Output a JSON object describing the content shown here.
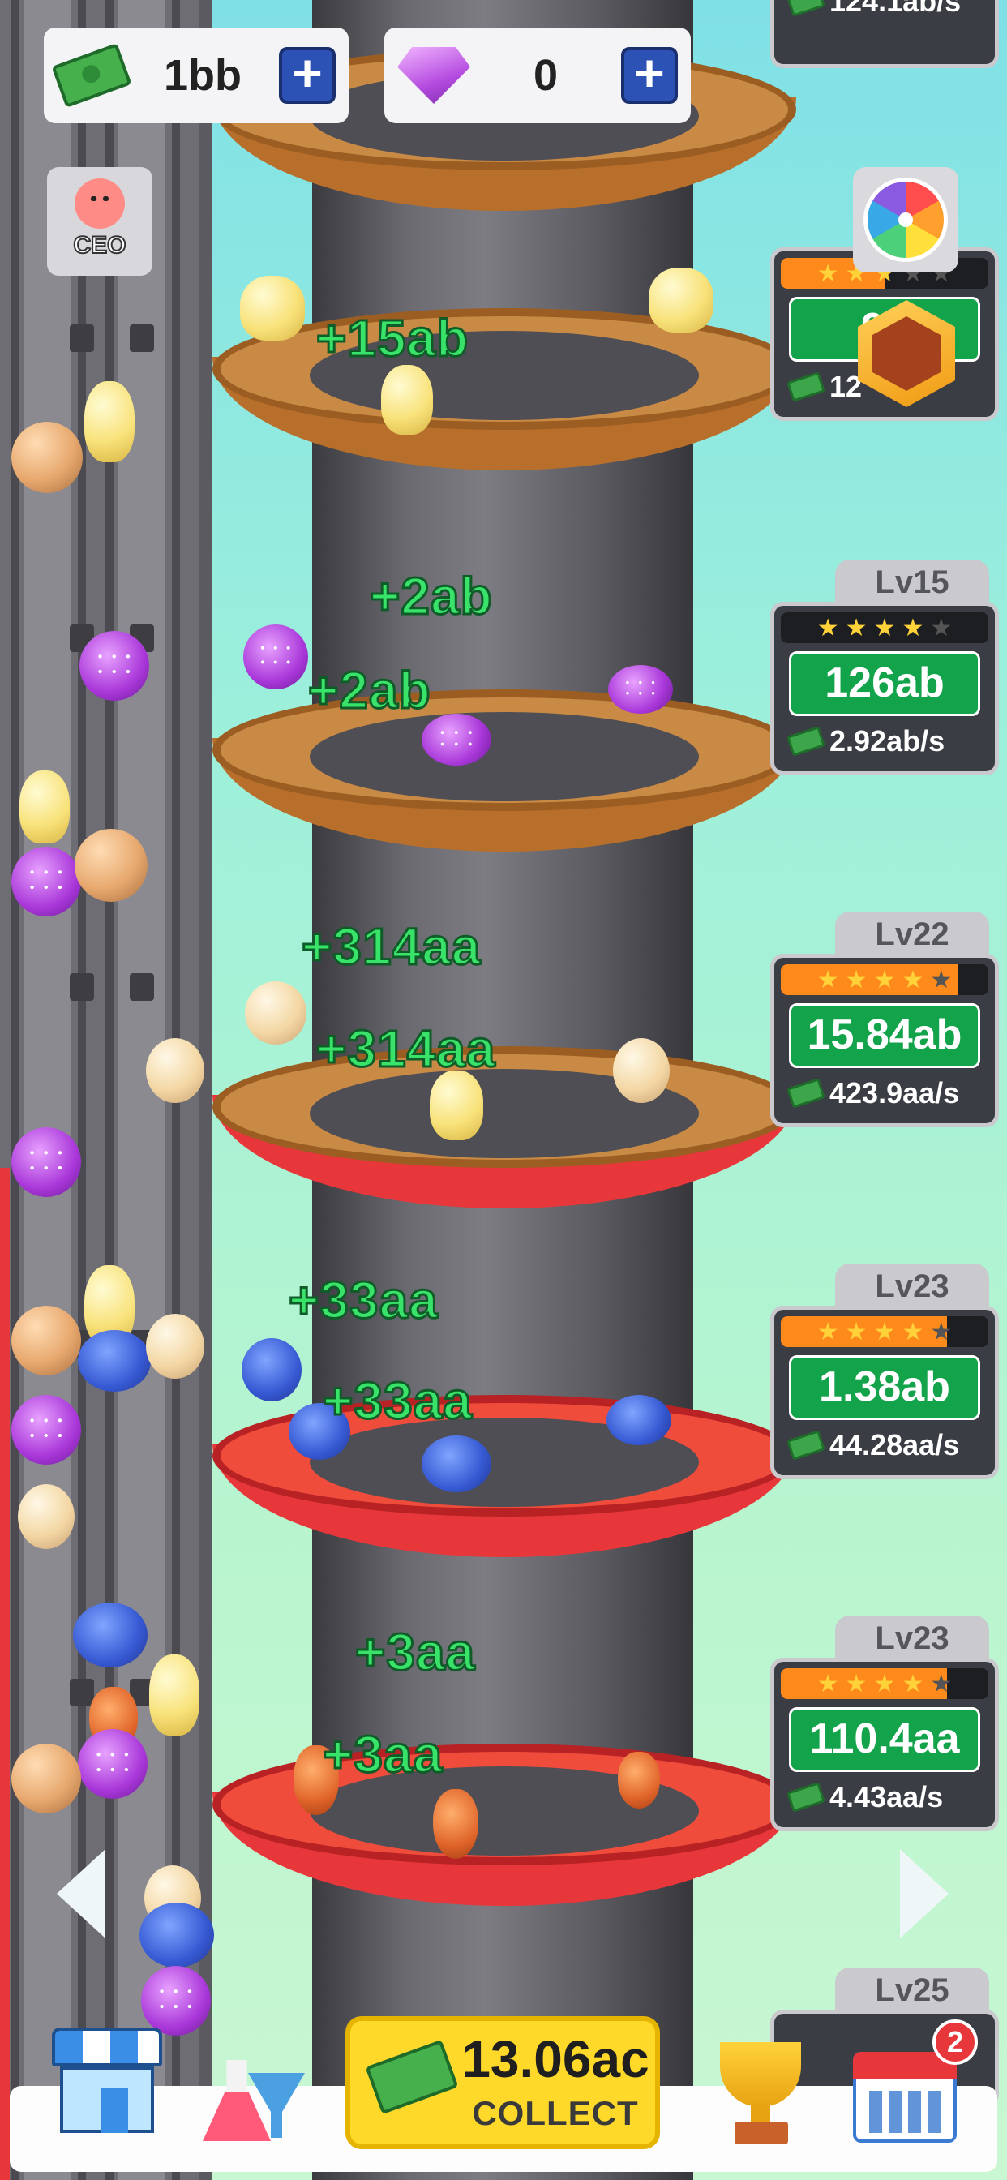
{
  "currency": {
    "cash_value": "1bb",
    "gems_value": "0"
  },
  "ceo_button": {
    "label": "CEO"
  },
  "floors": [
    {
      "level": "",
      "stars": 3,
      "star_fill": 0.5,
      "capacity": "96",
      "rate": "12",
      "popups": [
        "+15ab"
      ]
    },
    {
      "level": "Lv15",
      "stars": 4,
      "star_fill": 0.0,
      "capacity": "126ab",
      "rate": "2.92ab/s",
      "popups": [
        "+2ab",
        "+2ab"
      ]
    },
    {
      "level": "Lv22",
      "stars": 5,
      "star_fill": 0.85,
      "capacity": "15.84ab",
      "rate": "423.9aa/s",
      "popups": [
        "+314aa",
        "+314aa"
      ]
    },
    {
      "level": "Lv23",
      "stars": 5,
      "star_fill": 0.8,
      "capacity": "1.38ab",
      "rate": "44.28aa/s",
      "popups": [
        "+33aa",
        "+33aa"
      ]
    },
    {
      "level": "Lv23",
      "stars": 5,
      "star_fill": 0.8,
      "capacity": "110.4aa",
      "rate": "4.43aa/s",
      "popups": [
        "+3aa",
        "+3aa"
      ]
    },
    {
      "level": "Lv25"
    }
  ],
  "top_card_rate": "124.1ab/s",
  "collect": {
    "amount": "13.06ac",
    "label": "COLLECT"
  },
  "calendar_badge": "2",
  "icons": {
    "cash": "cash-stack-icon",
    "gem": "gem-icon",
    "plus": "plus-icon",
    "spin": "spin-wheel-icon",
    "hex": "hexagon-booster-icon",
    "shop": "shop-icon",
    "lab": "research-lab-icon",
    "trophy": "trophy-icon",
    "calendar": "calendar-icon",
    "arrow_left": "arrow-left-icon",
    "arrow_right": "arrow-right-icon"
  }
}
